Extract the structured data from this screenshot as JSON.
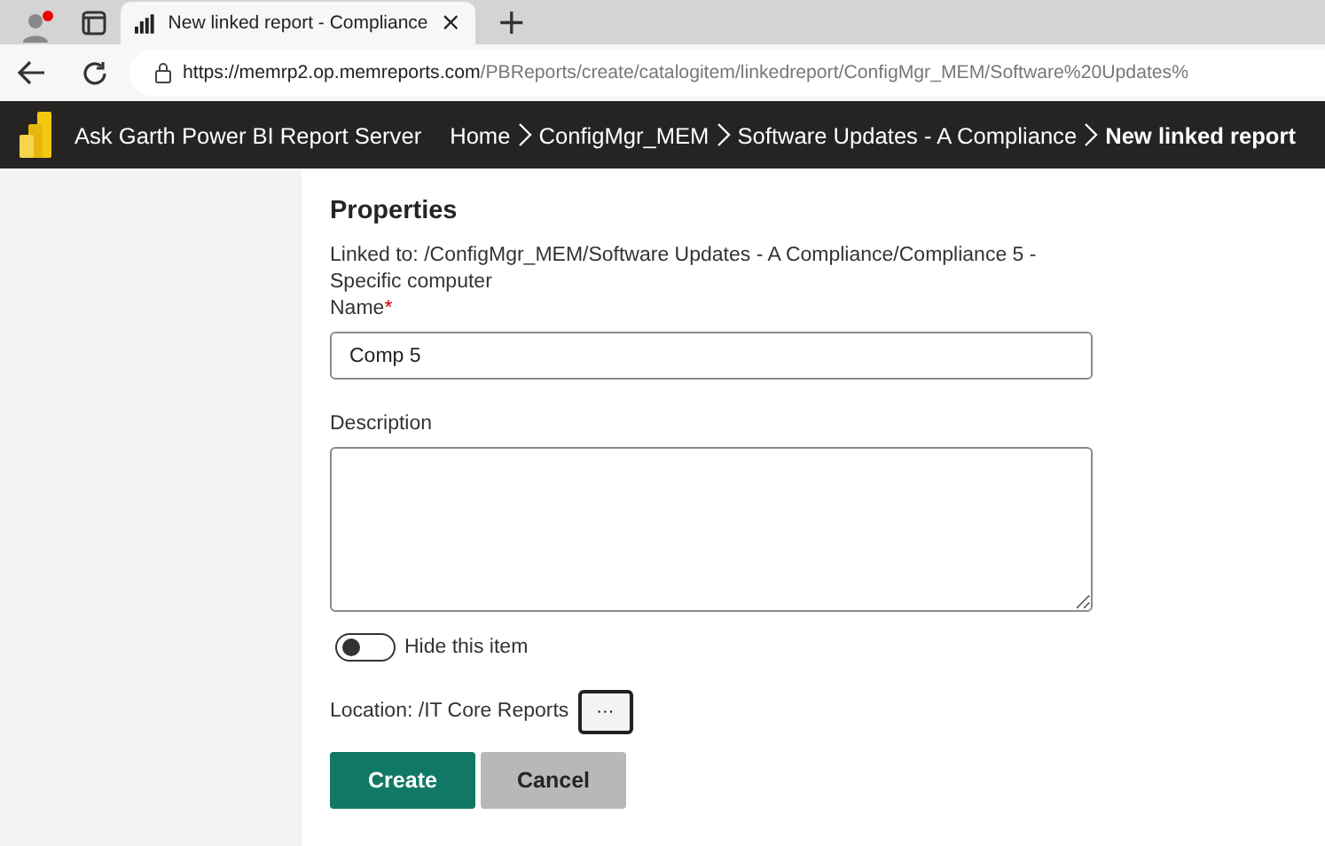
{
  "browser": {
    "tab": {
      "title": "New linked report - Compliance",
      "close": "×"
    },
    "new_tab": "+",
    "address": {
      "host": "https://memrp2.op.memreports.com",
      "path": "/PBReports/create/catalogitem/linkedreport/ConfigMgr_MEM/Software%20Updates%"
    }
  },
  "header": {
    "title": "Ask Garth Power BI Report Server",
    "breadcrumbs": [
      {
        "label": "Home",
        "current": false
      },
      {
        "label": "ConfigMgr_MEM",
        "current": false
      },
      {
        "label": "Software Updates - A Compliance",
        "current": false
      },
      {
        "label": "New linked report",
        "current": true
      }
    ]
  },
  "form": {
    "heading": "Properties",
    "linked_to": "Linked to: /ConfigMgr_MEM/Software Updates - A Compliance/Compliance 5 - Specific computer",
    "name": {
      "label": "Name",
      "required_mark": "*",
      "value": "Comp 5"
    },
    "description": {
      "label": "Description"
    },
    "hide": {
      "label": "Hide this item",
      "on": false
    },
    "location": {
      "label": "Location: /IT Core Reports",
      "button": "···"
    },
    "buttons": [
      {
        "label": "Create",
        "kind": "primary"
      },
      {
        "label": "Cancel",
        "kind": "secondary"
      }
    ]
  }
}
